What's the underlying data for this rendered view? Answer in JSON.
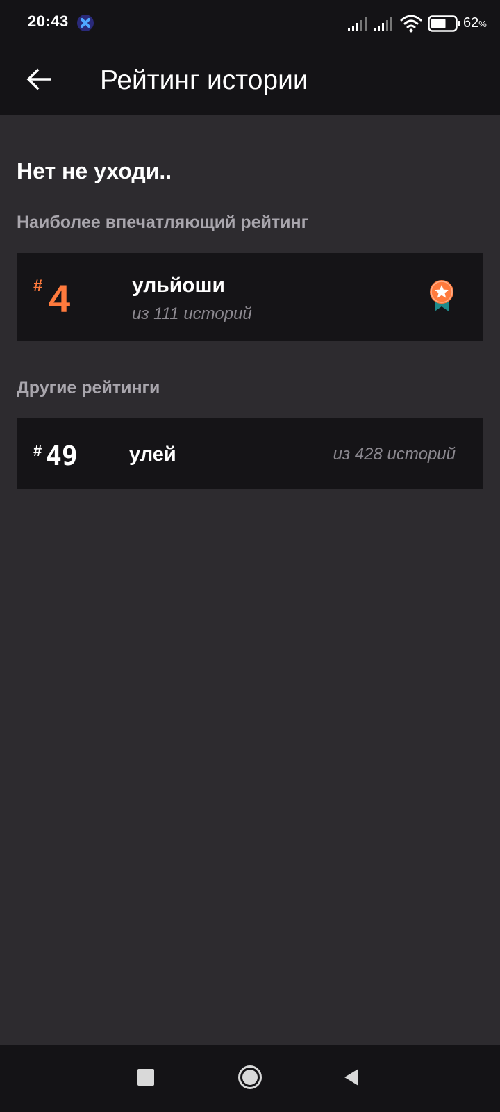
{
  "status_bar": {
    "time": "20:43",
    "battery_percent": "62",
    "battery_unit": "%",
    "battery_level": 0.62,
    "icons": [
      "app-notification-icon",
      "signal-icon",
      "signal-icon",
      "wifi-icon",
      "battery-icon"
    ]
  },
  "app_bar": {
    "back_icon": "arrow-left-icon",
    "title": "Рейтинг истории"
  },
  "main": {
    "heading": "Нет не уходи..",
    "top_section": {
      "title": "Наиболее впечатляющий рейтинг",
      "card": {
        "hash": "#",
        "rank": "4",
        "name": "ульйоши",
        "count": "из 111 историй",
        "icon": "medal-icon"
      }
    },
    "other_section": {
      "title": "Другие рейтинги",
      "cards": [
        {
          "hash": "#",
          "rank": "49",
          "name": "улей",
          "count": "из 428 историй"
        }
      ]
    }
  },
  "nav_bar": {
    "icons": [
      "recents-square-icon",
      "home-circle-icon",
      "back-triangle-icon"
    ]
  },
  "colors": {
    "background": "#2d2b2f",
    "bar": "#141316",
    "card": "#151417",
    "accent": "#ff7a3d",
    "muted": "#8c8990",
    "section_title": "#a9a6ad",
    "medal_ribbon": "#1f8a8a"
  }
}
